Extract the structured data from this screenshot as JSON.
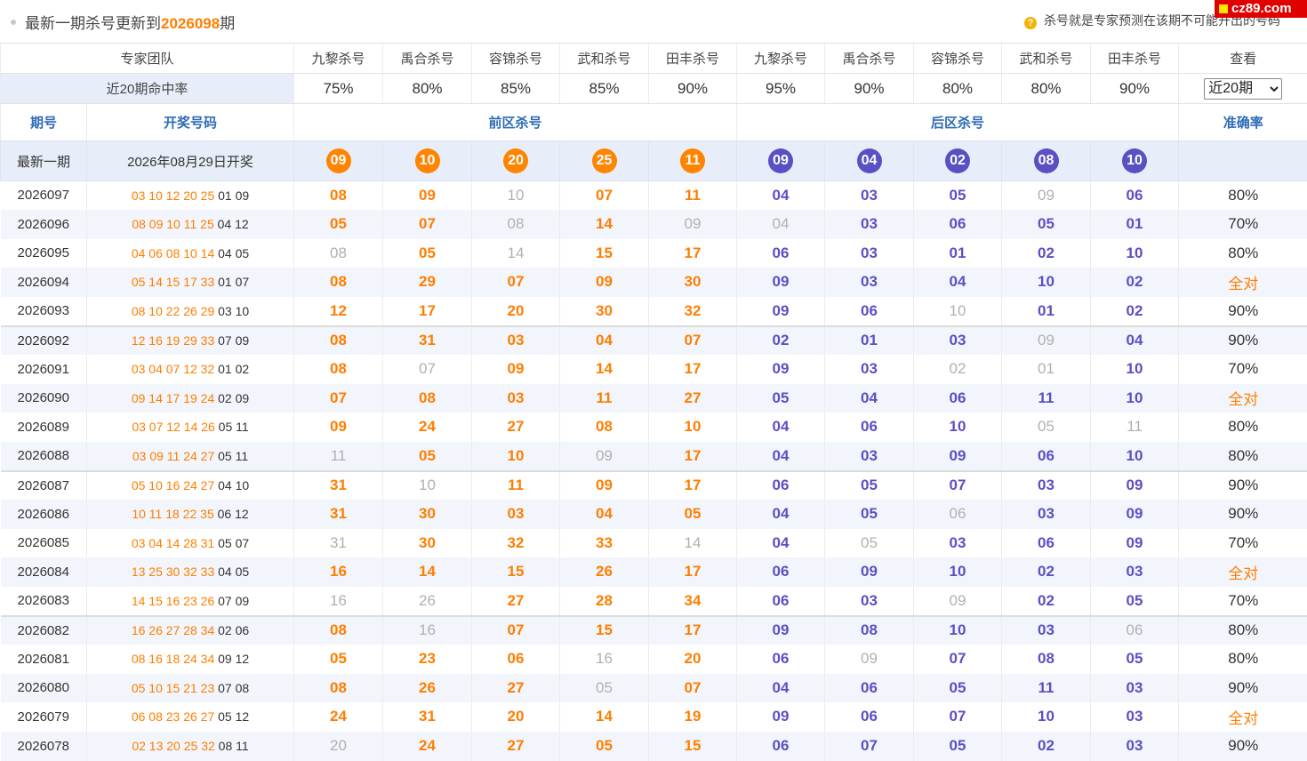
{
  "header": {
    "prefix": "最新一期杀号更新到",
    "issue": "2026098",
    "suffix": "期",
    "hint": "杀号就是专家预测在该期不可能开出的号码",
    "badge": "cz89.com"
  },
  "colors": {
    "front": "#ff8400",
    "back": "#5b4fc4",
    "miss": "#b0b0b0",
    "link": "#2e6bb5",
    "highlight": "#e8eef9"
  },
  "experts_label": "专家团队",
  "experts": [
    "九黎杀号",
    "禹合杀号",
    "容锦杀号",
    "武和杀号",
    "田丰杀号",
    "九黎杀号",
    "禹合杀号",
    "容锦杀号",
    "武和杀号",
    "田丰杀号"
  ],
  "view_label": "查看",
  "rate_label": "近20期命中率",
  "rates": [
    "75%",
    "80%",
    "85%",
    "85%",
    "90%",
    "95%",
    "90%",
    "80%",
    "80%",
    "90%"
  ],
  "select_value": "近20期",
  "columns": {
    "issue": "期号",
    "draw": "开奖号码",
    "front": "前区杀号",
    "back": "后区杀号",
    "accuracy": "准确率"
  },
  "latest": {
    "label": "最新一期",
    "date": "2026年08月29日开奖",
    "front": [
      "09",
      "10",
      "20",
      "25",
      "11"
    ],
    "back": [
      "09",
      "04",
      "02",
      "08",
      "10"
    ]
  },
  "rows": [
    {
      "issue": "2026097",
      "draw_front": "03 10 12 20 25",
      "draw_back": "01 09",
      "kills": [
        "08",
        "09",
        "10",
        "07",
        "11",
        "04",
        "03",
        "05",
        "09",
        "06"
      ],
      "miss": [
        2,
        8
      ],
      "accuracy": "80%"
    },
    {
      "issue": "2026096",
      "draw_front": "08 09 10 11 25",
      "draw_back": "04 12",
      "kills": [
        "05",
        "07",
        "08",
        "14",
        "09",
        "04",
        "03",
        "06",
        "05",
        "01"
      ],
      "miss": [
        2,
        4,
        5
      ],
      "accuracy": "70%"
    },
    {
      "issue": "2026095",
      "draw_front": "04 06 08 10 14",
      "draw_back": "04 05",
      "kills": [
        "08",
        "05",
        "14",
        "15",
        "17",
        "06",
        "03",
        "01",
        "02",
        "10"
      ],
      "miss": [
        0,
        2
      ],
      "accuracy": "80%"
    },
    {
      "issue": "2026094",
      "draw_front": "05 14 15 17 33",
      "draw_back": "01 07",
      "kills": [
        "08",
        "29",
        "07",
        "09",
        "30",
        "09",
        "03",
        "04",
        "10",
        "02"
      ],
      "miss": [],
      "accuracy": "全对"
    },
    {
      "issue": "2026093",
      "draw_front": "08 10 22 26 29",
      "draw_back": "03 10",
      "kills": [
        "12",
        "17",
        "20",
        "30",
        "32",
        "09",
        "06",
        "10",
        "01",
        "02"
      ],
      "miss": [
        7
      ],
      "accuracy": "90%"
    },
    {
      "issue": "2026092",
      "draw_front": "12 16 19 29 33",
      "draw_back": "07 09",
      "kills": [
        "08",
        "31",
        "03",
        "04",
        "07",
        "02",
        "01",
        "03",
        "09",
        "04"
      ],
      "miss": [
        8
      ],
      "accuracy": "90%"
    },
    {
      "issue": "2026091",
      "draw_front": "03 04 07 12 32",
      "draw_back": "01 02",
      "kills": [
        "08",
        "07",
        "09",
        "14",
        "17",
        "09",
        "03",
        "02",
        "01",
        "10"
      ],
      "miss": [
        1,
        7,
        8
      ],
      "accuracy": "70%"
    },
    {
      "issue": "2026090",
      "draw_front": "09 14 17 19 24",
      "draw_back": "02 09",
      "kills": [
        "07",
        "08",
        "03",
        "11",
        "27",
        "05",
        "04",
        "06",
        "11",
        "10"
      ],
      "miss": [],
      "accuracy": "全对"
    },
    {
      "issue": "2026089",
      "draw_front": "03 07 12 14 26",
      "draw_back": "05 11",
      "kills": [
        "09",
        "24",
        "27",
        "08",
        "10",
        "04",
        "06",
        "10",
        "05",
        "11"
      ],
      "miss": [
        8,
        9
      ],
      "accuracy": "80%"
    },
    {
      "issue": "2026088",
      "draw_front": "03 09 11 24 27",
      "draw_back": "05 11",
      "kills": [
        "11",
        "05",
        "10",
        "09",
        "17",
        "04",
        "03",
        "09",
        "06",
        "10"
      ],
      "miss": [
        0,
        3
      ],
      "accuracy": "80%"
    },
    {
      "issue": "2026087",
      "draw_front": "05 10 16 24 27",
      "draw_back": "04 10",
      "kills": [
        "31",
        "10",
        "11",
        "09",
        "17",
        "06",
        "05",
        "07",
        "03",
        "09"
      ],
      "miss": [
        1
      ],
      "accuracy": "90%"
    },
    {
      "issue": "2026086",
      "draw_front": "10 11 18 22 35",
      "draw_back": "06 12",
      "kills": [
        "31",
        "30",
        "03",
        "04",
        "05",
        "04",
        "05",
        "06",
        "03",
        "09"
      ],
      "miss": [
        7
      ],
      "accuracy": "90%"
    },
    {
      "issue": "2026085",
      "draw_front": "03 04 14 28 31",
      "draw_back": "05 07",
      "kills": [
        "31",
        "30",
        "32",
        "33",
        "14",
        "04",
        "05",
        "03",
        "06",
        "09"
      ],
      "miss": [
        0,
        4,
        6
      ],
      "accuracy": "70%"
    },
    {
      "issue": "2026084",
      "draw_front": "13 25 30 32 33",
      "draw_back": "04 05",
      "kills": [
        "16",
        "14",
        "15",
        "26",
        "17",
        "06",
        "09",
        "10",
        "02",
        "03"
      ],
      "miss": [],
      "accuracy": "全对"
    },
    {
      "issue": "2026083",
      "draw_front": "14 15 16 23 26",
      "draw_back": "07 09",
      "kills": [
        "16",
        "26",
        "27",
        "28",
        "34",
        "06",
        "03",
        "09",
        "02",
        "05"
      ],
      "miss": [
        0,
        1,
        7
      ],
      "accuracy": "70%"
    },
    {
      "issue": "2026082",
      "draw_front": "16 26 27 28 34",
      "draw_back": "02 06",
      "kills": [
        "08",
        "16",
        "07",
        "15",
        "17",
        "09",
        "08",
        "10",
        "03",
        "06"
      ],
      "miss": [
        1,
        9
      ],
      "accuracy": "80%"
    },
    {
      "issue": "2026081",
      "draw_front": "08 16 18 24 34",
      "draw_back": "09 12",
      "kills": [
        "05",
        "23",
        "06",
        "16",
        "20",
        "06",
        "09",
        "07",
        "08",
        "05"
      ],
      "miss": [
        3,
        6
      ],
      "accuracy": "80%"
    },
    {
      "issue": "2026080",
      "draw_front": "05 10 15 21 23",
      "draw_back": "07 08",
      "kills": [
        "08",
        "26",
        "27",
        "05",
        "07",
        "04",
        "06",
        "05",
        "11",
        "03"
      ],
      "miss": [
        3
      ],
      "accuracy": "90%"
    },
    {
      "issue": "2026079",
      "draw_front": "06 08 23 26 27",
      "draw_back": "05 12",
      "kills": [
        "24",
        "31",
        "20",
        "14",
        "19",
        "09",
        "06",
        "07",
        "10",
        "03"
      ],
      "miss": [],
      "accuracy": "全对"
    },
    {
      "issue": "2026078",
      "draw_front": "02 13 20 25 32",
      "draw_back": "08 11",
      "kills": [
        "20",
        "24",
        "27",
        "05",
        "15",
        "06",
        "07",
        "05",
        "02",
        "03"
      ],
      "miss": [
        0
      ],
      "accuracy": "90%"
    }
  ]
}
